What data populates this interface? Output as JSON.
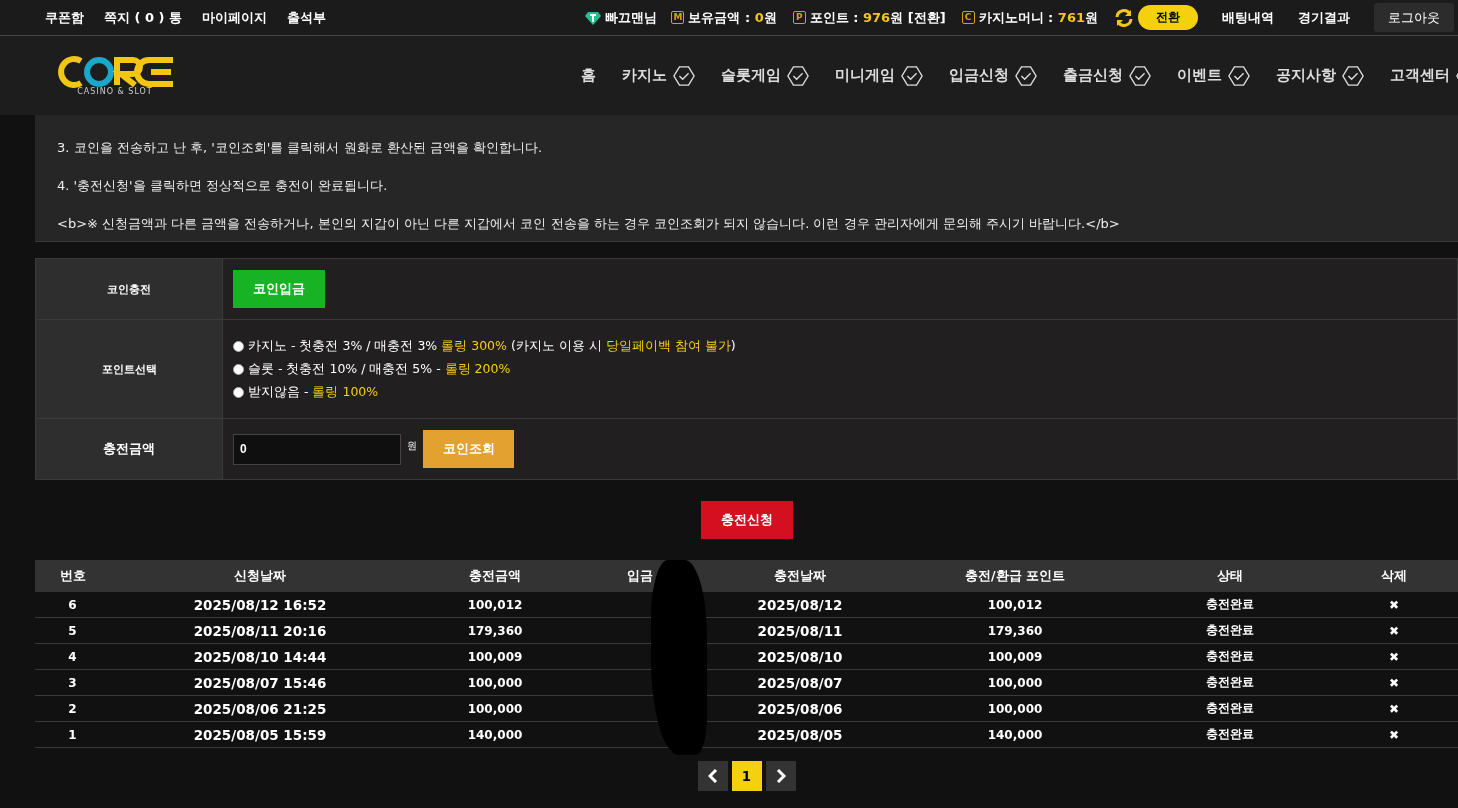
{
  "top_bar": {
    "links": [
      "쿠폰함",
      "쪽지 ( 0 ) 통",
      "마이페이지",
      "출석부"
    ],
    "user": {
      "name": "빠끄맨님"
    },
    "balance": {
      "icon": "M",
      "label": "보유금액 : ",
      "value": "0",
      "unit": "원"
    },
    "points": {
      "icon": "P",
      "label": "포인트 : ",
      "value": "976",
      "unit": "원 [전환]"
    },
    "casino_money": {
      "icon": "C",
      "label": "카지노머니 : ",
      "value": "761",
      "unit": "원"
    },
    "convert_button": "전환",
    "right_links": [
      "배팅내역",
      "경기결과"
    ],
    "logout_button": "로그아웃"
  },
  "logo": {
    "sub": "CASINO & SLOT"
  },
  "nav": [
    {
      "label": "홈",
      "check": false
    },
    {
      "label": "카지노",
      "check": true
    },
    {
      "label": "슬롯게임",
      "check": true
    },
    {
      "label": "미니게임",
      "check": true
    },
    {
      "label": "입금신청",
      "check": true
    },
    {
      "label": "출금신청",
      "check": true
    },
    {
      "label": "이벤트",
      "check": true
    },
    {
      "label": "공지사항",
      "check": true
    },
    {
      "label": "고객센터",
      "check": true
    }
  ],
  "notice": [
    "3. 코인을 전송하고 난 후, '코인조회'를 클릭해서 원화로 환산된 금액을 확인합니다.",
    "4. '충전신청'을 클릭하면 정상적으로 충전이 완료됩니다.",
    "<b>※ 신청금액과 다른 금액을 전송하거나, 본인의 지갑이 아닌 다른 지갑에서 코인 전송을 하는 경우 코인조회가 되지 않습니다. 이런 경우 관리자에게 문의해 주시기 바랍니다.</b>"
  ],
  "form": {
    "coin_label": "코인충전",
    "coin_button": "코인입금",
    "point_label": "포인트선택",
    "options": [
      {
        "parts": [
          {
            "text": "카지노 - 첫충전 3% / 매충전 3% ",
            "hl": false
          },
          {
            "text": "롤링 300%",
            "hl": true
          },
          {
            "text": " (카지노 이용 시 ",
            "hl": false
          },
          {
            "text": "당일페이백 참여 불가",
            "hl": true
          },
          {
            "text": ")",
            "hl": false
          }
        ],
        "selected": false
      },
      {
        "parts": [
          {
            "text": "슬롯 - 첫충전 10% / 매충전 5% - ",
            "hl": false
          },
          {
            "text": "롤링 200%",
            "hl": true
          }
        ],
        "selected": false
      },
      {
        "parts": [
          {
            "text": "받지않음 - ",
            "hl": false
          },
          {
            "text": "롤링 100%",
            "hl": true
          }
        ],
        "selected": false
      }
    ],
    "amount_label": "충전금액",
    "amount_value": "0",
    "amount_unit": "원",
    "check_button": "코인조회"
  },
  "submit_button": "충전신청",
  "table": {
    "columns": [
      "번호",
      "신청날짜",
      "충전금액",
      "입금",
      "충전날짜",
      "충전/환급 포인트",
      "상태",
      "삭제"
    ],
    "rows": [
      {
        "no": "6",
        "requested": "2025/08/12 16:52",
        "amount": "100,012",
        "date": "2025/08/12",
        "points": "100,012",
        "status": "충전완료",
        "delete": "✖"
      },
      {
        "no": "5",
        "requested": "2025/08/11 20:16",
        "amount": "179,360",
        "date": "2025/08/11",
        "points": "179,360",
        "status": "충전완료",
        "delete": "✖"
      },
      {
        "no": "4",
        "requested": "2025/08/10 14:44",
        "amount": "100,009",
        "date": "2025/08/10",
        "points": "100,009",
        "status": "충전완료",
        "delete": "✖"
      },
      {
        "no": "3",
        "requested": "2025/08/07 15:46",
        "amount": "100,000",
        "date": "2025/08/07",
        "points": "100,000",
        "status": "충전완료",
        "delete": "✖"
      },
      {
        "no": "2",
        "requested": "2025/08/06 21:25",
        "amount": "100,000",
        "date": "2025/08/06",
        "points": "100,000",
        "status": "충전완료",
        "delete": "✖"
      },
      {
        "no": "1",
        "requested": "2025/08/05 15:59",
        "amount": "140,000",
        "date": "2025/08/05",
        "points": "140,000",
        "status": "충전완료",
        "delete": "✖"
      }
    ]
  },
  "pagination": {
    "pages": [
      {
        "label": "1",
        "selected": true
      }
    ]
  }
}
